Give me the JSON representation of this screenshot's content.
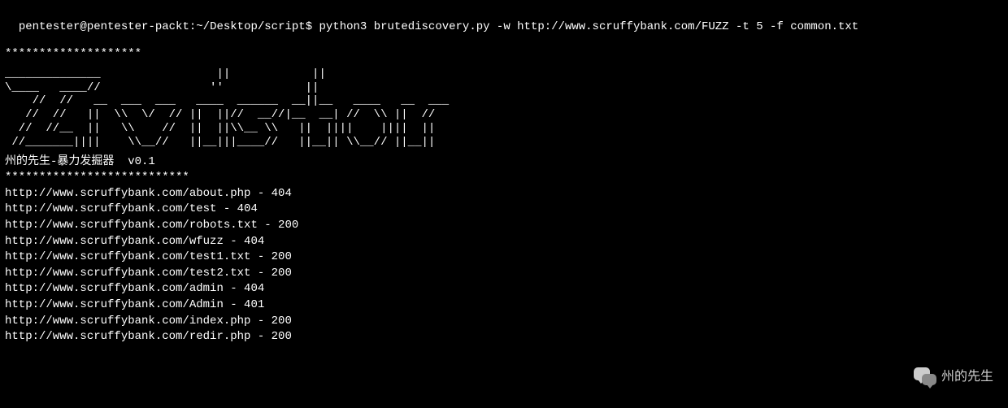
{
  "prompt": {
    "user_host": "pentester@pentester-packt",
    "path": "~/Desktop/script",
    "symbol": "$",
    "command": "python3 brutediscovery.py -w http://www.scruffybank.com/FUZZ -t 5 -f common.txt"
  },
  "separator_top": "********************",
  "ascii_art": "______________                 ||            ||\n\\____   ____//                ''            ||\n    //  //   __  ___  ___   ____  ______  __||__   ____   __  ___\n   //  //   ||  \\\\  \\/  // ||  ||//  __//|__  __| //  \\\\ ||  //\n  //  //__  ||   \\\\    //  ||  ||\\\\__ \\\\   ||  ||||    ||||  ||\n //_______||||    \\\\__//   ||__|||____//   ||__|| \\\\__// ||__||",
  "version_line": "州的先生-暴力发掘器  v0.1",
  "separator_bottom": "***************************",
  "results": [
    {
      "url": "http://www.scruffybank.com/about.php",
      "status": "404"
    },
    {
      "url": "http://www.scruffybank.com/test",
      "status": "404"
    },
    {
      "url": "http://www.scruffybank.com/robots.txt",
      "status": "200"
    },
    {
      "url": "http://www.scruffybank.com/wfuzz",
      "status": "404"
    },
    {
      "url": "http://www.scruffybank.com/test1.txt",
      "status": "200"
    },
    {
      "url": "http://www.scruffybank.com/test2.txt",
      "status": "200"
    },
    {
      "url": "http://www.scruffybank.com/admin",
      "status": "404"
    },
    {
      "url": "http://www.scruffybank.com/Admin",
      "status": "401"
    },
    {
      "url": "http://www.scruffybank.com/index.php",
      "status": "200"
    },
    {
      "url": "http://www.scruffybank.com/redir.php",
      "status": "200"
    }
  ],
  "watermark": {
    "text": "州的先生"
  }
}
